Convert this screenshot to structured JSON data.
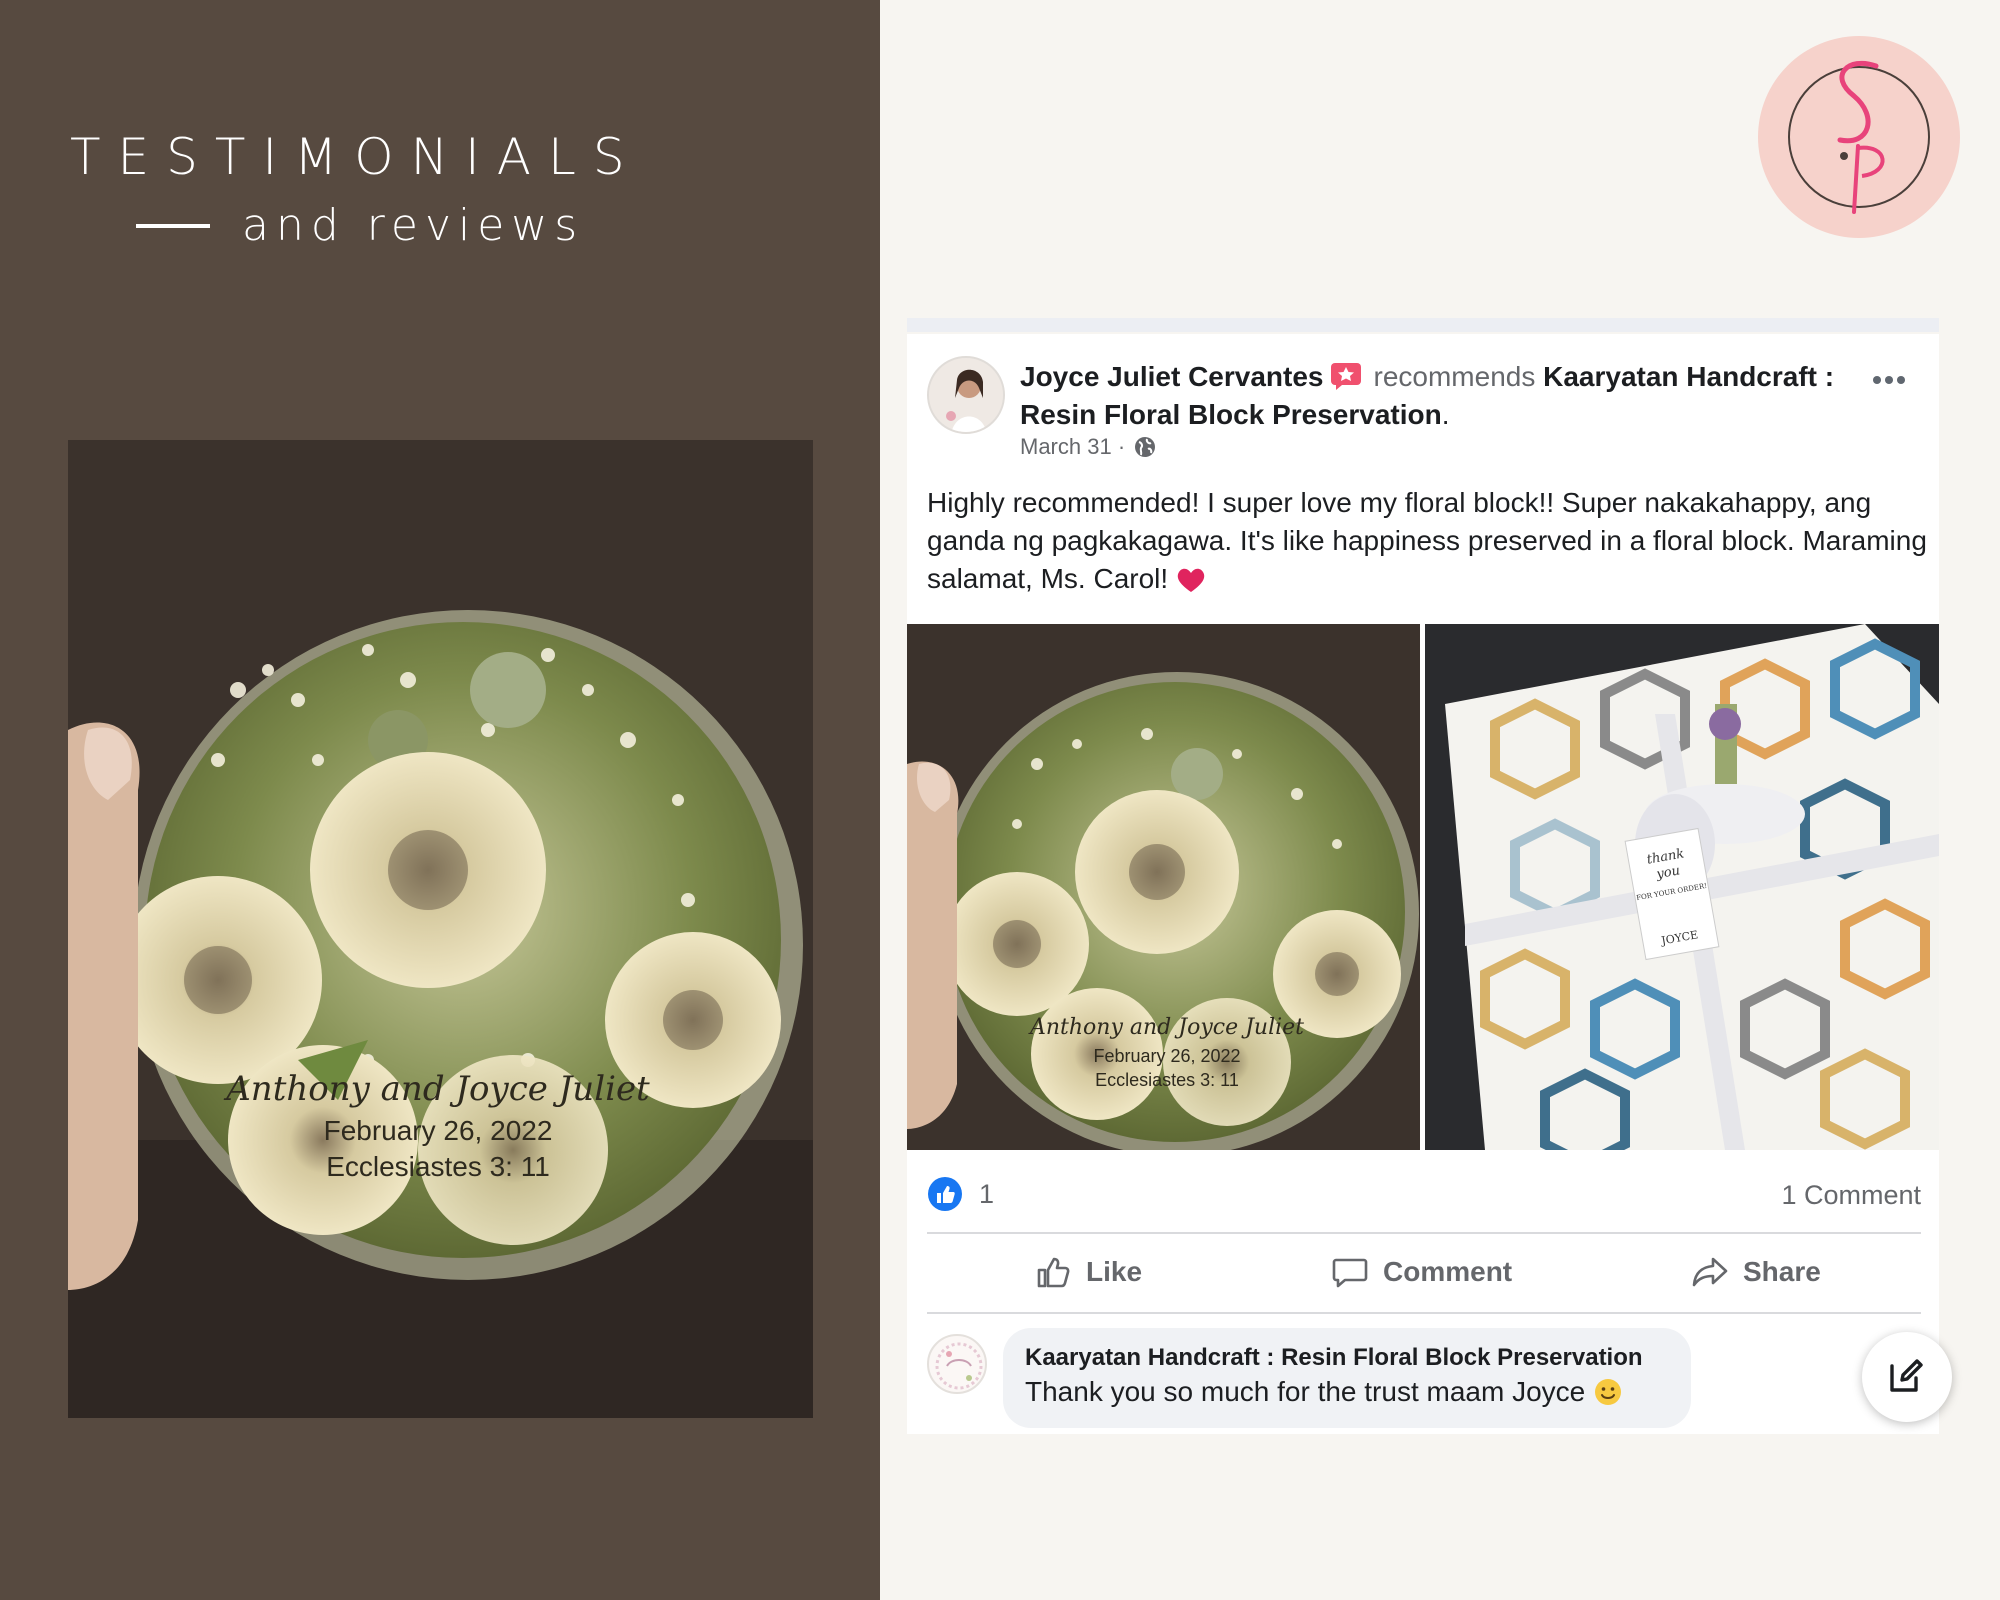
{
  "slide": {
    "heading": "TESTIMONIALS",
    "subheading": "and reviews",
    "colors": {
      "panel": "#574a40",
      "background": "#f7f5f1",
      "logo_bg": "#f6d2cb",
      "logo_accent": "#e8437b"
    },
    "logo_lettering": "S.P"
  },
  "post": {
    "author": "Joyce Juliet Cervantes",
    "verb": "recommends",
    "page_name": "Kaaryatan Handcraft : Resin Floral Block Preservation",
    "date": "March 31 ·",
    "body": "Highly recommended! I super love my floral block!! Super nakakahappy, ang ganda ng pagkakagawa. It's like happiness preserved in a floral block. Maraming salamat, Ms. Carol!",
    "photos": [
      {
        "engraving": [
          "Anthony and Joyce Juliet",
          "February 26, 2022",
          "Ecclesiastes 3: 11"
        ]
      },
      {
        "tag_lines": [
          "thank",
          "you",
          "FOR YOUR ORDER!",
          "JOYCE"
        ]
      }
    ],
    "reaction_count": "1",
    "comment_count": "1 Comment",
    "actions": {
      "like": "Like",
      "comment": "Comment",
      "share": "Share"
    },
    "comment": {
      "author": "Kaaryatan Handcraft : Resin Floral Block Preservation",
      "text": "Thank you so much for the trust maam Joyce"
    }
  },
  "hero_photo": {
    "engraving": [
      "Anthony and Joyce Juliet",
      "February 26, 2022",
      "Ecclesiastes 3: 11"
    ]
  },
  "icons": [
    "verified-badge-icon",
    "globe-icon",
    "more-icon",
    "heart-icon",
    "like-badge-icon",
    "thumbs-up-icon",
    "comment-icon",
    "share-icon",
    "smile-icon",
    "compose-icon"
  ],
  "link_color": "#1877f2"
}
